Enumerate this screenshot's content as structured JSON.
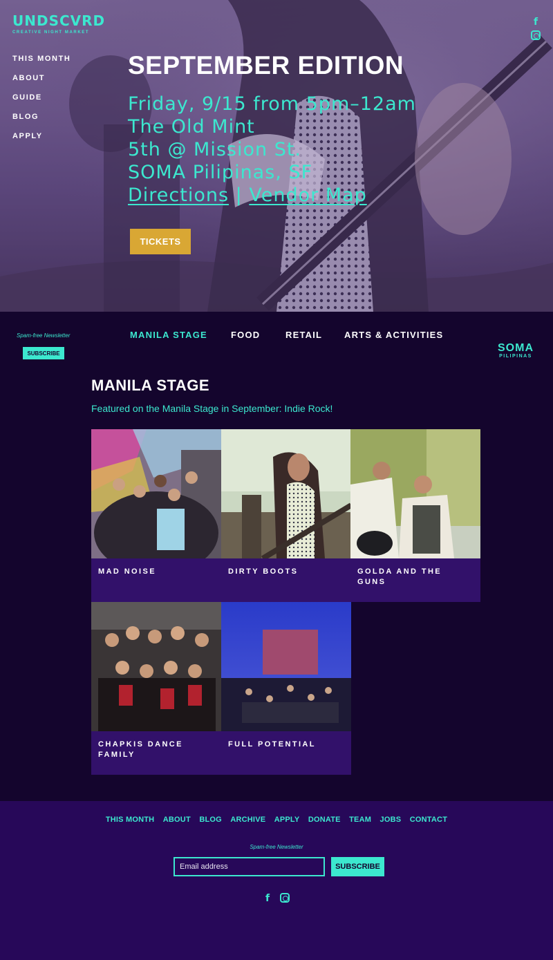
{
  "logo": {
    "word": "UNDSCVRD",
    "tagline": "CREATIVE NIGHT MARKET"
  },
  "side_nav": [
    "THIS MONTH",
    "ABOUT",
    "GUIDE",
    "BLOG",
    "APPLY"
  ],
  "social": {
    "facebook_glyph": "f",
    "icons": [
      "facebook-icon",
      "instagram-icon"
    ]
  },
  "hero": {
    "title": "SEPTEMBER EDITION",
    "lines": [
      "Friday, 9/15 from 5pm–12am",
      "The Old Mint",
      "5th @ Mission St.",
      "SOMA Pilipinas, SF"
    ],
    "link_directions": "Directions",
    "separator": "|",
    "link_vendor_map": "Vendor Map",
    "tickets_label": "TICKETS"
  },
  "newsletter_side": {
    "label": "Spam-free Newsletter",
    "button": "SUBSCRIBE"
  },
  "tabs": [
    "MANILA STAGE",
    "FOOD",
    "RETAIL",
    "ARTS & ACTIVITIES"
  ],
  "soma_logo": {
    "top": "SOMA",
    "bottom": "PILIPINAS"
  },
  "section": {
    "title": "MANILA STAGE",
    "description": "Featured on the Manila Stage in September: Indie Rock!"
  },
  "acts": [
    {
      "name": "MAD NOISE"
    },
    {
      "name": "DIRTY BOOTS"
    },
    {
      "name": "GOLDA AND THE GUNS"
    },
    {
      "name": "CHAPKIS DANCE FAMILY"
    },
    {
      "name": "FULL POTENTIAL"
    }
  ],
  "footer": {
    "links": [
      "THIS MONTH",
      "ABOUT",
      "BLOG",
      "ARCHIVE",
      "APPLY",
      "DONATE",
      "TEAM",
      "JOBS",
      "CONTACT"
    ],
    "newsletter_label": "Spam-free Newsletter",
    "email_placeholder": "Email address",
    "subscribe": "SUBSCRIBE"
  },
  "colors": {
    "accent": "#3ce8cf",
    "dark": "#14052d",
    "footer": "#270859",
    "tile_caption": "#32116a",
    "tickets": "#d9a734"
  }
}
